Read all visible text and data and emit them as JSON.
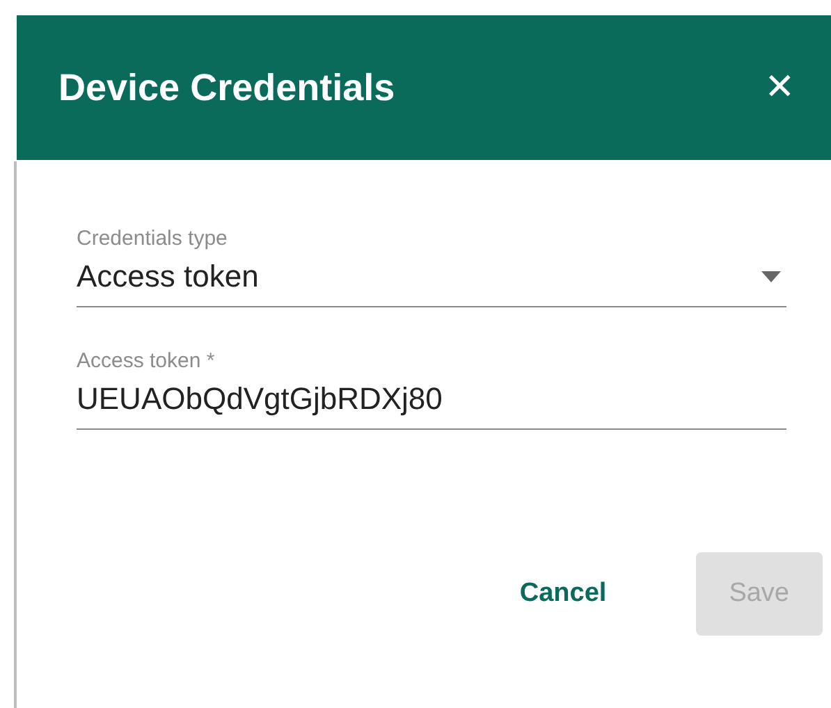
{
  "dialog": {
    "title": "Device Credentials",
    "close": "✕"
  },
  "fields": [
    {
      "kind": "select",
      "label": "Credentials type",
      "value": "Access token"
    },
    {
      "kind": "text",
      "label": "Access token *",
      "value": "UEUAObQdVgtGjbRDXj80"
    }
  ],
  "buttons": [
    {
      "label": "Cancel",
      "disabled": false,
      "kind": "flat"
    },
    {
      "label": "Save",
      "disabled": true,
      "kind": "raised"
    }
  ]
}
